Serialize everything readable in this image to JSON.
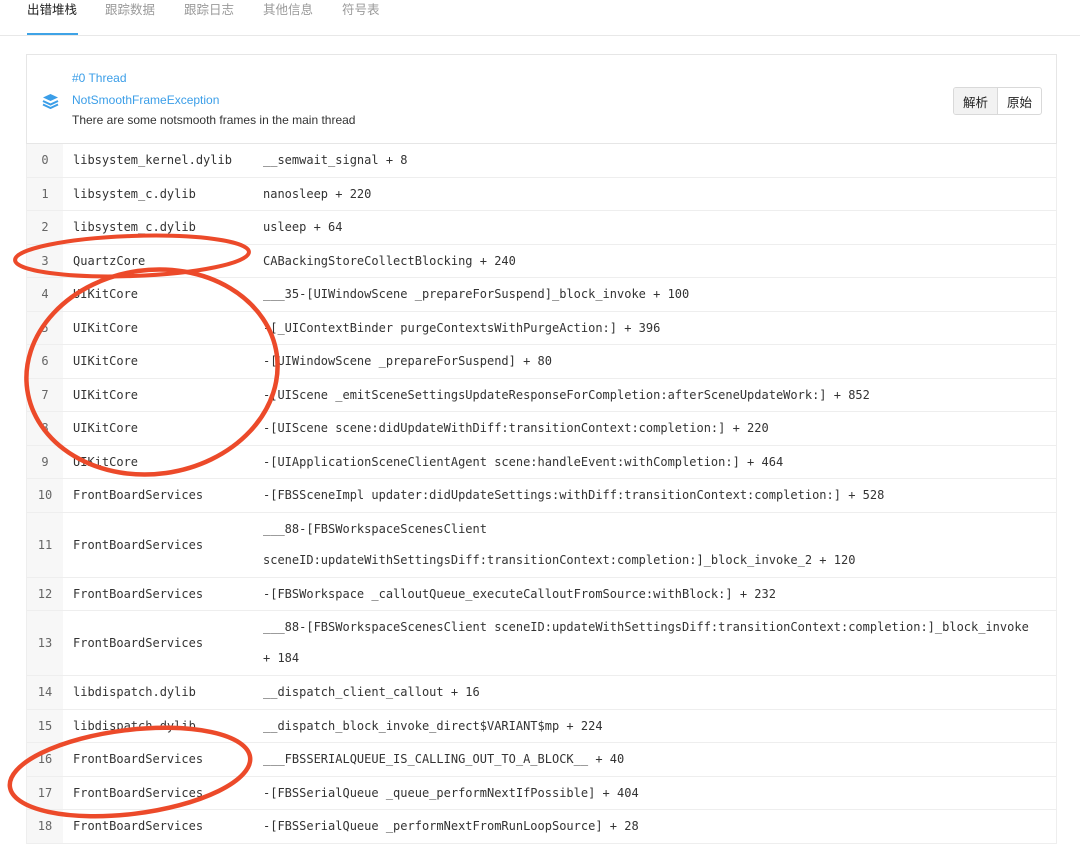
{
  "tabs": [
    {
      "label": "出错堆栈",
      "active": true
    },
    {
      "label": "跟踪数据"
    },
    {
      "label": "跟踪日志"
    },
    {
      "label": "其他信息"
    },
    {
      "label": "符号表"
    }
  ],
  "thread": {
    "id": "#0 Thread",
    "exception": "NotSmoothFrameException",
    "message": "There are some notsmooth frames in the main thread",
    "icon": "layers-icon",
    "accent_color": "#3b9ee8"
  },
  "actions": {
    "parse_label": "解析",
    "raw_label": "原始"
  },
  "frames": [
    {
      "index": "0",
      "library": "libsystem_kernel.dylib",
      "symbol": "__semwait_signal + 8"
    },
    {
      "index": "1",
      "library": "libsystem_c.dylib",
      "symbol": "nanosleep + 220"
    },
    {
      "index": "2",
      "library": "libsystem_c.dylib",
      "symbol": "usleep + 64"
    },
    {
      "index": "3",
      "library": "QuartzCore",
      "symbol": "CABackingStoreCollectBlocking + 240"
    },
    {
      "index": "4",
      "library": "UIKitCore",
      "symbol": "___35-[UIWindowScene _prepareForSuspend]_block_invoke + 100"
    },
    {
      "index": "5",
      "library": "UIKitCore",
      "symbol": "-[_UIContextBinder purgeContextsWithPurgeAction:] + 396"
    },
    {
      "index": "6",
      "library": "UIKitCore",
      "symbol": "-[UIWindowScene _prepareForSuspend] + 80"
    },
    {
      "index": "7",
      "library": "UIKitCore",
      "symbol": "-[UIScene _emitSceneSettingsUpdateResponseForCompletion:afterSceneUpdateWork:] + 852"
    },
    {
      "index": "8",
      "library": "UIKitCore",
      "symbol": "-[UIScene scene:didUpdateWithDiff:transitionContext:completion:] + 220"
    },
    {
      "index": "9",
      "library": "UIKitCore",
      "symbol": "-[UIApplicationSceneClientAgent scene:handleEvent:withCompletion:] + 464"
    },
    {
      "index": "10",
      "library": "FrontBoardServices",
      "symbol": "-[FBSSceneImpl updater:didUpdateSettings:withDiff:transitionContext:completion:] + 528"
    },
    {
      "index": "11",
      "library": "FrontBoardServices",
      "symbol": "___88-[FBSWorkspaceScenesClient sceneID:updateWithSettingsDiff:transitionContext:completion:]_block_invoke_2 + 120",
      "wrapped": true
    },
    {
      "index": "12",
      "library": "FrontBoardServices",
      "symbol": "-[FBSWorkspace _calloutQueue_executeCalloutFromSource:withBlock:] + 232"
    },
    {
      "index": "13",
      "library": "FrontBoardServices",
      "symbol": "___88-[FBSWorkspaceScenesClient sceneID:updateWithSettingsDiff:transitionContext:completion:]_block_invoke + 184",
      "wrapped": true
    },
    {
      "index": "14",
      "library": "libdispatch.dylib",
      "symbol": "__dispatch_client_callout + 16"
    },
    {
      "index": "15",
      "library": "libdispatch.dylib",
      "symbol": "__dispatch_block_invoke_direct$VARIANT$mp + 224"
    },
    {
      "index": "16",
      "library": "FrontBoardServices",
      "symbol": "___FBSSERIALQUEUE_IS_CALLING_OUT_TO_A_BLOCK__ + 40"
    },
    {
      "index": "17",
      "library": "FrontBoardServices",
      "symbol": "-[FBSSerialQueue _queue_performNextIfPossible] + 404"
    },
    {
      "index": "18",
      "library": "FrontBoardServices",
      "symbol": "-[FBSSerialQueue _performNextFromRunLoopSource] + 28"
    }
  ],
  "annotation_color": "#ec4a2a"
}
